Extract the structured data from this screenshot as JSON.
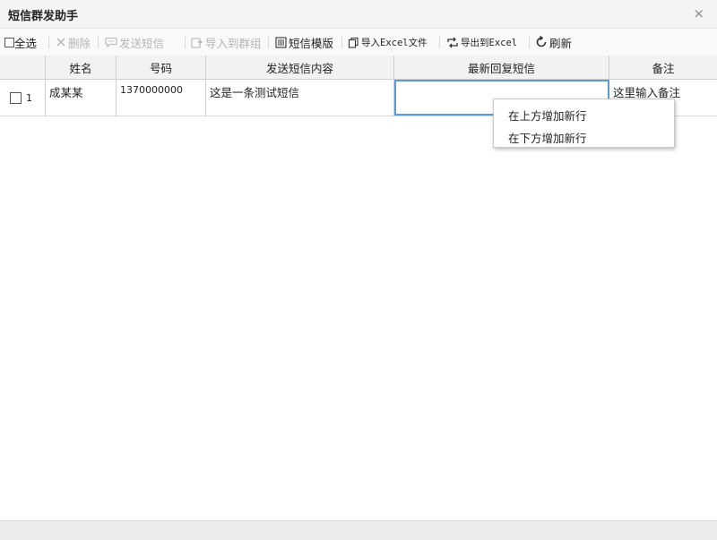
{
  "window": {
    "title": "短信群发助手",
    "close_icon": "×"
  },
  "toolbar": {
    "select_all": "全选",
    "delete": "删除",
    "send_sms": "发送短信",
    "import_group": "导入到群组",
    "sms_template": "短信模版",
    "import_excel": "导入Excel文件",
    "export_excel": "导出到Excel",
    "refresh": "刷新"
  },
  "table": {
    "columns": [
      "姓名",
      "号码",
      "发送短信内容",
      "最新回复短信",
      "备注"
    ],
    "rows": [
      {
        "index": "1",
        "name": "成某某",
        "phone": "1370000000",
        "content": "这是一条测试短信",
        "reply": "",
        "note": "这里输入备注"
      }
    ]
  },
  "context_menu": {
    "items": [
      "在上方增加新行",
      "在下方增加新行"
    ]
  },
  "colors": {
    "edit_border": "#5b9bd5",
    "disabled_text": "#b5b5b5"
  }
}
